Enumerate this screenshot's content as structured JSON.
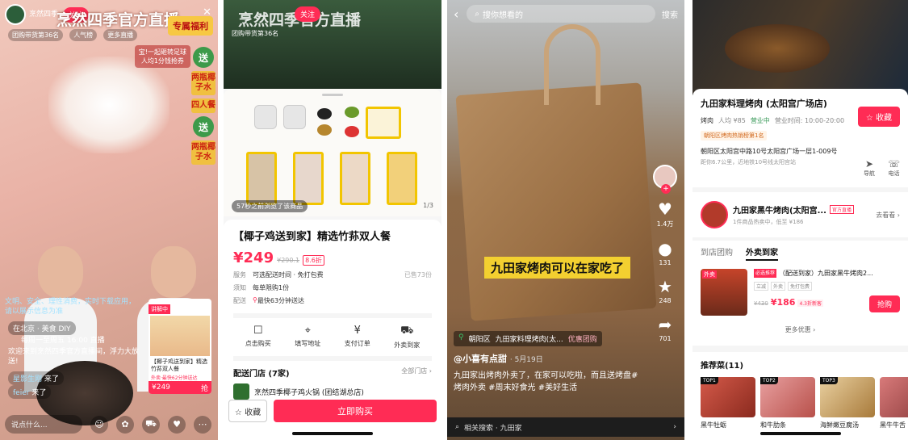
{
  "panel1": {
    "host_name": "烹然四季",
    "follow": "关注",
    "title": "烹然四季官方直播",
    "exclusive": "专属福利",
    "rank_badge": "团购带货第36名",
    "popularity": "人气榜",
    "more_perks": "更多直播",
    "promo": "宝!一起砸转足球",
    "promo_sub": "人均1分钱抢券",
    "side_gifts": [
      {
        "label": "送"
      },
      {
        "label": "两瓶椰子水"
      },
      {
        "label": "四人餐"
      },
      {
        "label": "送"
      },
      {
        "label": "两瓶椰子水"
      }
    ],
    "notice": "文明、安全、理性消费，实时下载应用，请以展示信息为准",
    "diy": "在北京 · 美食 DIY",
    "schedule": "每周一至周五 16:00 直播",
    "welcome": "欢迎来到烹然四季官方直播间，浮力大放送!",
    "messages": [
      {
        "user": "星影生刚",
        "text": "来了"
      },
      {
        "user": "feier",
        "text": "来了"
      }
    ],
    "card": {
      "tag": "讲解中",
      "name": "【椰子鸡送到家】精选竹荪双人餐",
      "sub": "外卖·最快62分钟送达",
      "price": "¥249",
      "buy": "抢"
    },
    "say_placeholder": "说点什么..."
  },
  "panel2": {
    "video_title": "烹然四季官方直播",
    "follow": "关注",
    "rank": "团购带货第36名",
    "viewed": "57秒之前浏览了该商品",
    "image_count": "1/3",
    "product_name": "【椰子鸡送到家】精选竹荪双人餐",
    "price": "¥249",
    "orig_price": "¥290.1",
    "discount": "8.6折",
    "service_k": "服务",
    "service_v": "可选配送时间 · 免打包费",
    "sold": "已售73份",
    "notice_k": "须知",
    "notice_v": "每单限购1份",
    "delivery_k": "配送",
    "delivery_v": "最快63分钟送达",
    "steps": [
      {
        "icon": "☐",
        "label": "点击购买"
      },
      {
        "icon": "⌖",
        "label": "填写地址"
      },
      {
        "icon": "¥",
        "label": "支付订单"
      },
      {
        "icon": "⛟",
        "label": "外卖到家"
      }
    ],
    "stores_title": "配送门店 (7家)",
    "all_stores": "全部门店 ›",
    "store_name": "烹然四季椰子鸡火锅 (团结湖总店)",
    "fav": "☆ 收藏",
    "buy_now": "立即购买"
  },
  "panel3": {
    "search_placeholder": "搜你想看的",
    "search_button": "搜索",
    "caption": "九田家烤肉可以在家吃了",
    "likes": "1.4万",
    "comments": "131",
    "favorites": "248",
    "shares": "701",
    "location": "朝阳区",
    "location_store": "九田家料理烤肉(太...",
    "group_buy": "优惠团购",
    "author": "@小喜有点甜",
    "date": "· 5月19日",
    "description": "九田家出烤肉外卖了，在家可以吃啦，而且送烤盘#烤肉外卖 #周末好食光 #美好生活",
    "related_label": "相关搜索 · 九田家"
  },
  "panel4": {
    "store_name": "九田家料理烤肉 (太阳宫广场店)",
    "fav": "☆ 收藏",
    "category": "烤肉",
    "avg_price": "人均 ¥85",
    "open_label": "营业中",
    "hours": "营业时间: 10:00-20:00",
    "rank": "朝阳区烤肉热销榜第1名",
    "address": "朝阳区太阳宫中路10号太阳宫广场一层1-009号",
    "distance": "距你6.7公里，近地铁10号线太阳宫站",
    "nav": "导航",
    "call": "电话",
    "shop_name": "九田家黑牛烤肉(太阳宫...",
    "shop_tag": "官方直播",
    "shop_sub": "1件商品热卖中，低至 ¥186",
    "shop_go": "去看看 ›",
    "tabs": [
      "到店团购",
      "外卖到家"
    ],
    "deal": {
      "img_tag": "外卖",
      "hot": "必选推荐",
      "name": "（配送到家）九田家黑牛烤肉2...",
      "tags": [
        "立减",
        "外卖",
        "免打包费"
      ],
      "orig": "¥430",
      "now": "¥186",
      "new": "4.3折新客",
      "grab": "抢购"
    },
    "more_deals": "更多优惠 ›",
    "rec_title": "推荐菜(11)",
    "dishes": [
      {
        "top": "TOP1",
        "name": "黑牛牡蛎"
      },
      {
        "top": "TOP2",
        "name": "和牛肋条"
      },
      {
        "top": "TOP3",
        "name": "海鲜嫩豆腐汤"
      },
      {
        "top": "",
        "name": "黑牛牛舌"
      }
    ]
  }
}
